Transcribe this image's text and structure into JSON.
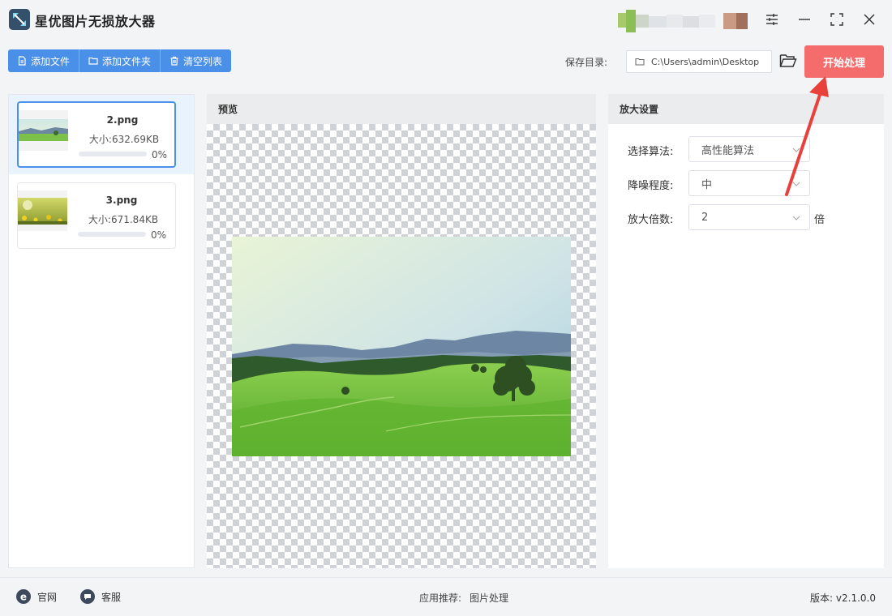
{
  "app": {
    "title": "星优图片无损放大器"
  },
  "toolbar": {
    "add_file": "添加文件",
    "add_folder": "添加文件夹",
    "clear_list": "清空列表",
    "save_dir_label": "保存目录:",
    "save_dir_value": "C:\\Users\\admin\\Desktop",
    "start": "开始处理"
  },
  "files": [
    {
      "name": "2.png",
      "size": "大小:632.69KB",
      "progress": "0%",
      "progress_value": 0,
      "selected": true
    },
    {
      "name": "3.png",
      "size": "大小:671.84KB",
      "progress": "0%",
      "progress_value": 0,
      "selected": false
    }
  ],
  "preview": {
    "title": "预览"
  },
  "settings": {
    "title": "放大设置",
    "algorithm_label": "选择算法:",
    "algorithm_value": "高性能算法",
    "denoise_label": "降噪程度:",
    "denoise_value": "中",
    "scale_label": "放大倍数:",
    "scale_value": "2",
    "scale_unit": "倍"
  },
  "footer": {
    "website": "官网",
    "support": "客服",
    "recommend_label": "应用推荐:",
    "recommend_link": "图片处理",
    "version": "版本: v2.1.0.0"
  },
  "colors": {
    "accent": "#4a90e8",
    "start": "#f56c6c",
    "annotation": "#e8403a"
  }
}
